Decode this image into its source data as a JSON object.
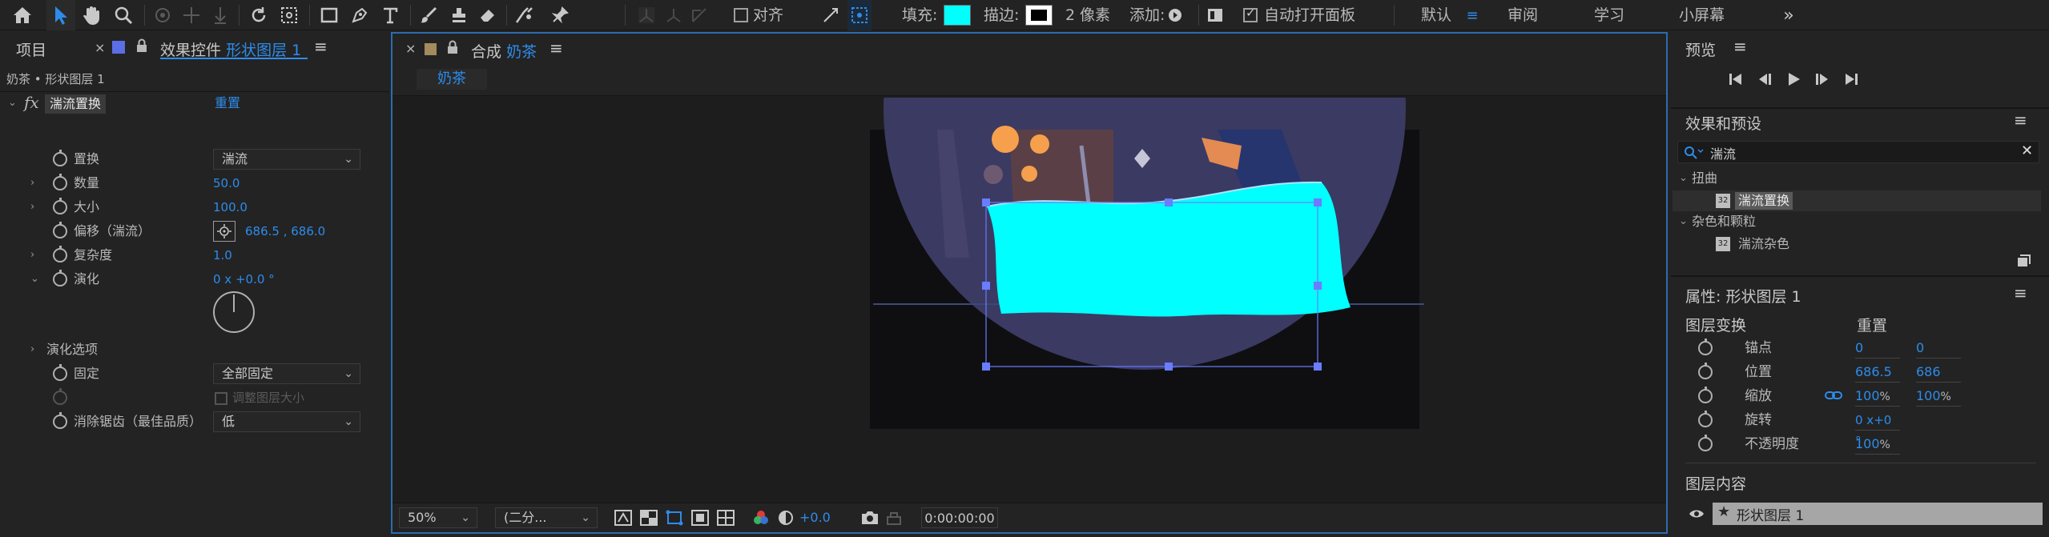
{
  "toolbar": {
    "align_label": "对齐",
    "fill_label": "填充:",
    "stroke_label": "描边:",
    "stroke_width": "2",
    "stroke_unit": "像素",
    "add_label": "添加:",
    "auto_open_label": "自动打开面板",
    "workspaces": [
      "默认",
      "审阅",
      "学习",
      "小屏幕"
    ],
    "fill_color": "#00ffff",
    "accent": "#2d8ceb"
  },
  "left_panel": {
    "tab_project": "项目",
    "tab_effects_prefix": "效果控件",
    "tab_effects_layer": "形状图层 1",
    "breadcrumb": "奶茶 • 形状图层 1",
    "effect_name": "湍流置换",
    "reset_label": "重置",
    "props": {
      "displace": {
        "label": "置换",
        "value": "湍流"
      },
      "amount": {
        "label": "数量",
        "value": "50.0"
      },
      "size": {
        "label": "大小",
        "value": "100.0"
      },
      "offset": {
        "label": "偏移（湍流）",
        "value": "686.5 , 686.0"
      },
      "complexity": {
        "label": "复杂度",
        "value": "1.0"
      },
      "evolution": {
        "label": "演化",
        "value": "0 x +0.0 °"
      },
      "evolution_options": {
        "label": "演化选项"
      },
      "pinning": {
        "label": "固定",
        "value": "全部固定"
      },
      "resize_layer": {
        "label": "调整图层大小"
      },
      "antialias": {
        "label": "消除锯齿（最佳品质）",
        "value": "低"
      }
    }
  },
  "comp_panel": {
    "tab_title_prefix": "合成",
    "tab_title_name": "奶茶",
    "subtab": "奶茶",
    "zoom": "50%",
    "resolution": "(二分...",
    "exposure": "+0.0",
    "timecode": "0:00:00:00"
  },
  "preview_panel": {
    "title": "预览"
  },
  "effects_presets": {
    "title": "效果和预设",
    "search_value": "湍流",
    "groups": [
      {
        "name": "扭曲",
        "items": [
          "湍流置换"
        ]
      },
      {
        "name": "杂色和颗粒",
        "items": [
          "湍流杂色"
        ]
      }
    ]
  },
  "properties": {
    "title": "属性: 形状图层 1",
    "transform_label": "图层变换",
    "reset_label": "重置",
    "anchor": {
      "label": "锚点",
      "x": "0",
      "y": "0"
    },
    "position": {
      "label": "位置",
      "x": "686.5",
      "y": "686"
    },
    "scale": {
      "label": "缩放",
      "x": "100",
      "y": "100",
      "unit": "%"
    },
    "rotation": {
      "label": "旋转",
      "value": "0 x+0 °"
    },
    "opacity": {
      "label": "不透明度",
      "value": "100",
      "unit": "%"
    },
    "contents_label": "图层内容",
    "layer_item": "形状图层 1"
  }
}
